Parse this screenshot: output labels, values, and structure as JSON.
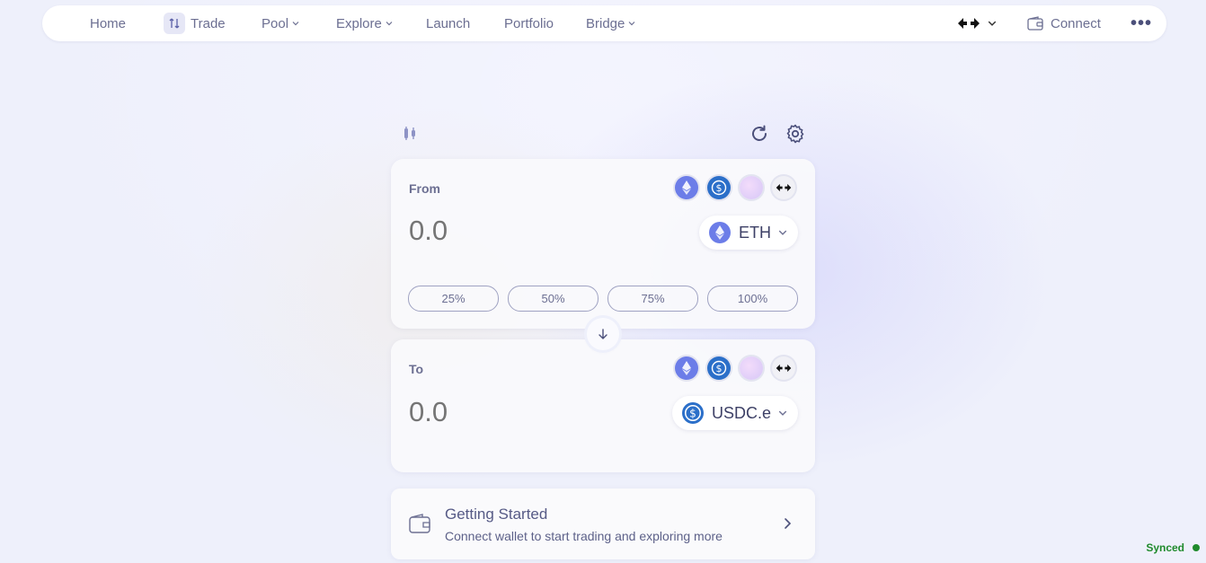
{
  "nav": {
    "home": "Home",
    "trade": "Trade",
    "pool": "Pool",
    "explore": "Explore",
    "launch": "Launch",
    "portfolio": "Portfolio",
    "bridge": "Bridge",
    "connect": "Connect",
    "more": "•••"
  },
  "from": {
    "label": "From",
    "amount_placeholder": "0.0",
    "token": "ETH",
    "percents": [
      "25%",
      "50%",
      "75%",
      "100%"
    ]
  },
  "to": {
    "label": "To",
    "amount_placeholder": "0.0",
    "token": "USDC.e"
  },
  "getting_started": {
    "title": "Getting Started",
    "subtitle": "Connect wallet to start trading and exploring more"
  },
  "status": {
    "text": "Synced",
    "color": "#1f8a2c"
  },
  "colors": {
    "eth": "#6c7de8",
    "usdc": "#2b6fc9",
    "accent": "#6c6f92"
  }
}
